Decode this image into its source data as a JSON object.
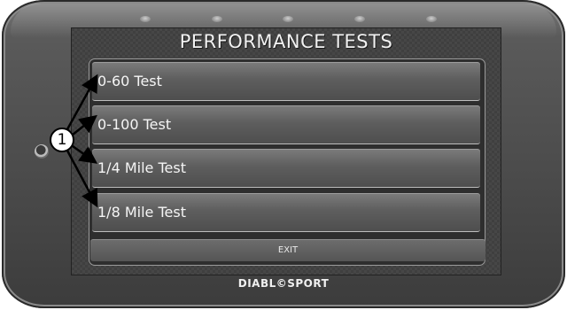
{
  "screen": {
    "title": "PERFORMANCE TESTS",
    "menu_items": [
      {
        "label": "0-60 Test"
      },
      {
        "label": "0-100 Test"
      },
      {
        "label": "1/4 Mile Test"
      },
      {
        "label": "1/8 Mile Test"
      }
    ],
    "exit_label": "EXIT"
  },
  "device": {
    "brand": "DIABL©SPORT",
    "led_count": 5
  },
  "callout": {
    "number": "1"
  }
}
